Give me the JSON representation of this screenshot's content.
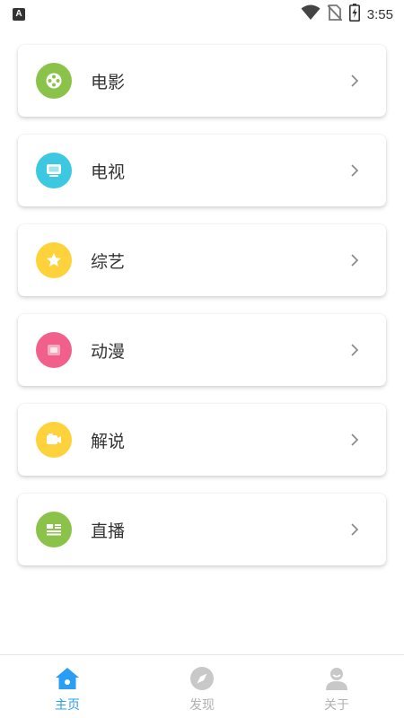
{
  "status_bar": {
    "notification_letter": "A",
    "time": "3:55",
    "icons": [
      "wifi-icon",
      "no-sim-icon",
      "battery-charging-icon"
    ]
  },
  "menu": {
    "items": [
      {
        "label": "电影",
        "icon": "film-reel-icon",
        "color": "#8bc34a"
      },
      {
        "label": "电视",
        "icon": "tv-icon",
        "color": "#3cc8e0"
      },
      {
        "label": "综艺",
        "icon": "star-icon",
        "color": "#fdd23a"
      },
      {
        "label": "动漫",
        "icon": "animation-icon",
        "color": "#f0608a"
      },
      {
        "label": "解说",
        "icon": "camera-icon",
        "color": "#fdd23a"
      },
      {
        "label": "直播",
        "icon": "live-list-icon",
        "color": "#8bc34a"
      }
    ]
  },
  "bottom_nav": {
    "active_color": "#2a9df4",
    "inactive_color": "#b0b0b0",
    "tabs": [
      {
        "label": "主页",
        "icon": "home-icon",
        "active": true
      },
      {
        "label": "发现",
        "icon": "compass-icon",
        "active": false
      },
      {
        "label": "关于",
        "icon": "person-icon",
        "active": false
      }
    ]
  }
}
